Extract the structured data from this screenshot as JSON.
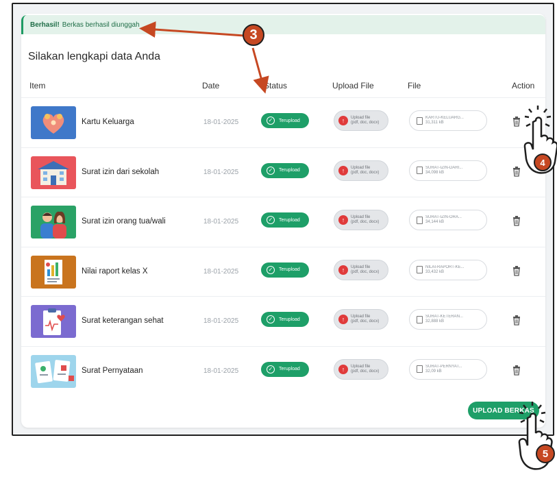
{
  "alert": {
    "strong": "Berhasil!",
    "text": "Berkas berhasil diunggah"
  },
  "page_title": "Silakan lengkapi data Anda",
  "columns": {
    "item": "Item",
    "date": "Date",
    "status": "Status",
    "upload": "Upload File",
    "file": "File",
    "action": "Action"
  },
  "rows": [
    {
      "name": "Kartu Keluarga",
      "date": "18-01-2025",
      "status": "Terupload",
      "upload_line1": "Upload file",
      "upload_line2": "(pdf, doc, docx)",
      "file_name": "KARTU-KELUARG...",
      "file_size": "31,311 kB"
    },
    {
      "name": "Surat izin dari sekolah",
      "date": "18-01-2025",
      "status": "Terupload",
      "upload_line1": "Upload file",
      "upload_line2": "(pdf, doc, docx)",
      "file_name": "SURAT-IZIN-DARI...",
      "file_size": "34,098 kB"
    },
    {
      "name": "Surat izin orang tua/wali",
      "date": "18-01-2025",
      "status": "Terupload",
      "upload_line1": "Upload file",
      "upload_line2": "(pdf, doc, docx)",
      "file_name": "SURAT-IZIN-ORA...",
      "file_size": "34,144 kB"
    },
    {
      "name": "Nilai raport kelas X",
      "date": "18-01-2025",
      "status": "Terupload",
      "upload_line1": "Upload file",
      "upload_line2": "(pdf, doc, docx)",
      "file_name": "NILAI-RAPORT-KE...",
      "file_size": "33,432 kB"
    },
    {
      "name": "Surat keterangan sehat",
      "date": "18-01-2025",
      "status": "Terupload",
      "upload_line1": "Upload file",
      "upload_line2": "(pdf, doc, docx)",
      "file_name": "SURAT-KETERAN...",
      "file_size": "32,888 kB"
    },
    {
      "name": "Surat Pernyataan",
      "date": "18-01-2025",
      "status": "Terupload",
      "upload_line1": "Upload file",
      "upload_line2": "(pdf, doc, docx)",
      "file_name": "SURAT-PERNYAT...",
      "file_size": "32,09 kB"
    }
  ],
  "upload_button": "UPLOAD BERKAS",
  "callouts": {
    "three": "3",
    "four": "4",
    "five": "5"
  },
  "colors": {
    "success": "#1e9f68",
    "alert_bg": "#e3f2ea",
    "callout": "#c64822",
    "upload_dot": "#e03b3b"
  },
  "icons": {
    "status": "check-circle-icon",
    "upload": "upload-icon",
    "file": "document-icon",
    "action": "trash-icon"
  }
}
